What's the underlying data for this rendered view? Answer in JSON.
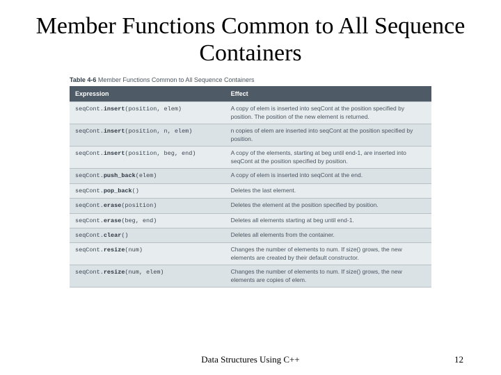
{
  "title": "Member Functions Common to All Sequence Containers",
  "table": {
    "caption_prefix": "Table 4-6",
    "caption_rest": " Member Functions Common to All Sequence Containers",
    "head": {
      "expr": "Expression",
      "effect": "Effect"
    },
    "rows": [
      {
        "expr_prefix": "seqCont.",
        "expr_fn": "insert",
        "expr_args": "(position, elem)",
        "effect": "A copy of elem is inserted into seqCont at the position specified by position. The position of the new element is returned."
      },
      {
        "expr_prefix": "seqCont.",
        "expr_fn": "insert",
        "expr_args": "(position, n, elem)",
        "effect": "n copies of elem are inserted into seqCont at the position specified by position."
      },
      {
        "expr_prefix": "seqCont.",
        "expr_fn": "insert",
        "expr_args": "(position, beg, end)",
        "effect": "A copy of the elements, starting at beg until end-1, are inserted into seqCont at the position specified by position."
      },
      {
        "expr_prefix": "seqCont.",
        "expr_fn": "push_back",
        "expr_args": "(elem)",
        "effect": "A copy of elem is inserted into seqCont at the end."
      },
      {
        "expr_prefix": "seqCont.",
        "expr_fn": "pop_back",
        "expr_args": "()",
        "effect": "Deletes the last element."
      },
      {
        "expr_prefix": "seqCont.",
        "expr_fn": "erase",
        "expr_args": "(position)",
        "effect": "Deletes the element at the position specified by position."
      },
      {
        "expr_prefix": "seqCont.",
        "expr_fn": "erase",
        "expr_args": "(beg, end)",
        "effect": "Deletes all elements starting at beg until end-1."
      },
      {
        "expr_prefix": "seqCont.",
        "expr_fn": "clear",
        "expr_args": "()",
        "effect": "Deletes all elements from the container."
      },
      {
        "expr_prefix": "seqCont.",
        "expr_fn": "resize",
        "expr_args": "(num)",
        "effect": "Changes the number of elements to num. If size() grows, the new elements are created by their default constructor."
      },
      {
        "expr_prefix": "seqCont.",
        "expr_fn": "resize",
        "expr_args": "(num, elem)",
        "effect": "Changes the number of elements to num. If size() grows, the new elements are copies of elem."
      }
    ]
  },
  "footer": {
    "center": "Data Structures Using C++",
    "page": "12"
  }
}
